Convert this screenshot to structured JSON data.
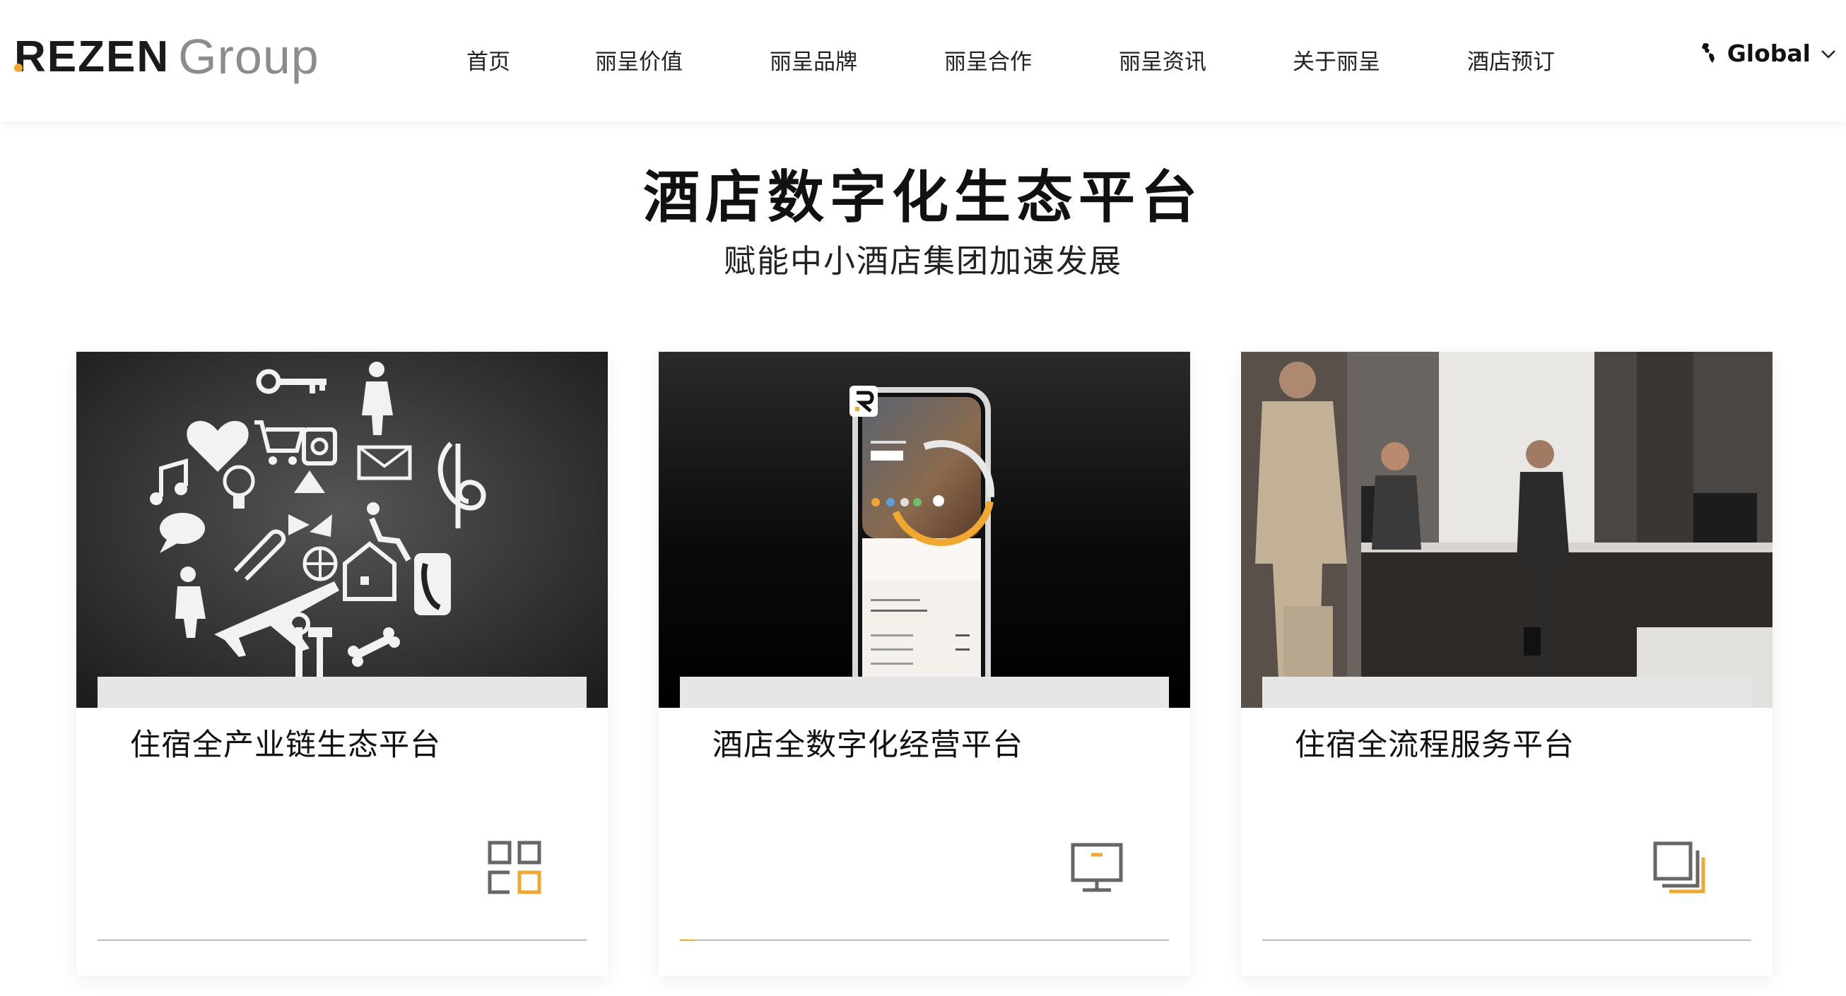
{
  "header": {
    "logo_main": "REZEN",
    "logo_sub": "Group",
    "accent_color": "#f0a830",
    "nav": [
      "首页",
      "丽呈价值",
      "丽呈品牌",
      "丽呈合作",
      "丽呈资讯",
      "关于丽呈",
      "酒店预订"
    ],
    "global_label": "Global",
    "global_icon": "globe-icon",
    "global_chevron": "chevron-down-icon"
  },
  "hero": {
    "title": "酒店数字化生态平台",
    "subtitle": "赋能中小酒店集团加速发展"
  },
  "cards": [
    {
      "title": "住宿全产业链生态平台",
      "icon": "grid-icon",
      "image": "lifestyle-icons-photo",
      "progress": 0
    },
    {
      "title": "酒店全数字化经营平台",
      "icon": "monitor-icon",
      "image": "smartphone-app-photo",
      "progress": 0.03
    },
    {
      "title": "住宿全流程服务平台",
      "icon": "layers-icon",
      "image": "hotel-lobby-photo",
      "progress": 0
    }
  ]
}
